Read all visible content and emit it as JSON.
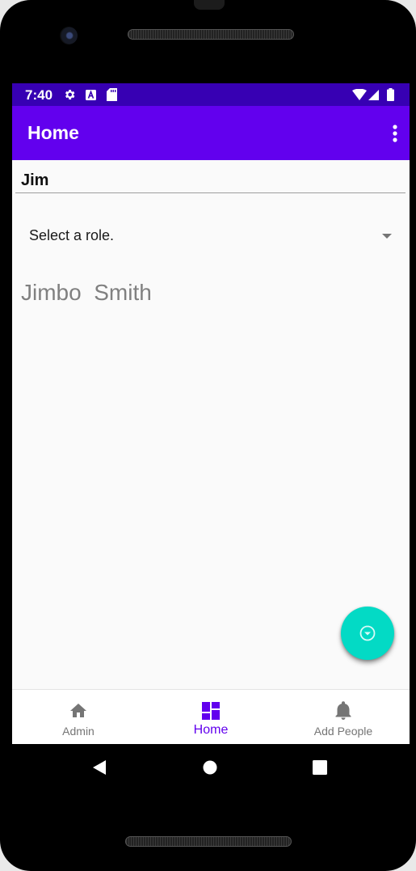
{
  "status_bar": {
    "time": "7:40",
    "icons": [
      "gear-icon",
      "a-badge-icon",
      "sd-card-icon",
      "wifi-icon",
      "signal-icon",
      "battery-icon"
    ]
  },
  "app_bar": {
    "title": "Home",
    "overflow_icon": "more-vert-icon"
  },
  "form": {
    "name_value": "Jim",
    "role_placeholder": "Select a role."
  },
  "result": {
    "person_name": "Jimbo  Smith"
  },
  "fab": {
    "icon": "arrow-circle-down-icon"
  },
  "bottom_nav": {
    "items": [
      {
        "label": "Admin",
        "icon": "home-icon",
        "active": false
      },
      {
        "label": "Home",
        "icon": "dashboard-icon",
        "active": true
      },
      {
        "label": "Add People",
        "icon": "bell-icon",
        "active": false
      }
    ]
  },
  "system_nav": {
    "icons": [
      "back-icon",
      "home-circle-icon",
      "recents-icon"
    ]
  },
  "colors": {
    "status_bar": "#3700b3",
    "primary": "#6200ee",
    "accent": "#03dac5",
    "background": "#fafafa",
    "inactive": "#757575"
  }
}
